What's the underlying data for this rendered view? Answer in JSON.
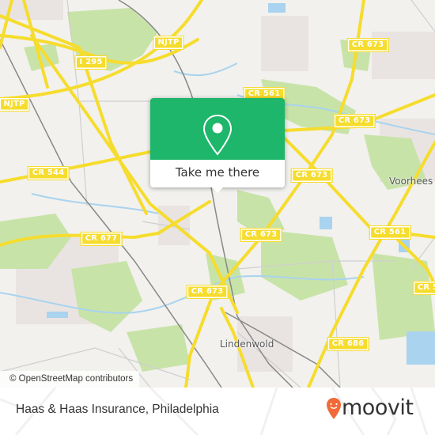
{
  "map": {
    "colors": {
      "background": "#f2f1ee",
      "park": "#c8e3a8",
      "water": "#a9d3ee",
      "urban": "#e8e2df",
      "road_major": "#f6dc2d",
      "road_minor": "#cfcfcf",
      "railway": "#888888"
    },
    "road_shields": [
      {
        "id": "njtp-top",
        "label": "NJTP"
      },
      {
        "id": "i295",
        "label": "I 295"
      },
      {
        "id": "njtp-left",
        "label": "NJTP"
      },
      {
        "id": "cr673-top",
        "label": "CR 673"
      },
      {
        "id": "cr561-top",
        "label": "CR 561"
      },
      {
        "id": "cr673-mid",
        "label": "CR 673"
      },
      {
        "id": "cr544",
        "label": "CR 544"
      },
      {
        "id": "cr673-center",
        "label": "CR 673"
      },
      {
        "id": "cr677",
        "label": "CR 677"
      },
      {
        "id": "cr673-right",
        "label": "CR 673"
      },
      {
        "id": "cr561-right",
        "label": "CR 561"
      },
      {
        "id": "cr561-edge",
        "label": "CR 5"
      },
      {
        "id": "cr673-low",
        "label": "CR 673"
      },
      {
        "id": "cr686",
        "label": "CR 686"
      }
    ],
    "places": [
      {
        "id": "voorhees",
        "label": "Voorhees"
      },
      {
        "id": "lindenwold",
        "label": "Lindenwold"
      }
    ],
    "attribution": "© OpenStreetMap contributors"
  },
  "popup": {
    "icon": "map-pin-icon",
    "button_label": "Take me there",
    "accent": "#1db66a"
  },
  "footer": {
    "place_name": "Haas & Haas Insurance, Philadelphia",
    "logo_text": "moovit",
    "logo_icon": "moovit-pin-icon",
    "logo_color": "#f26a3a"
  }
}
